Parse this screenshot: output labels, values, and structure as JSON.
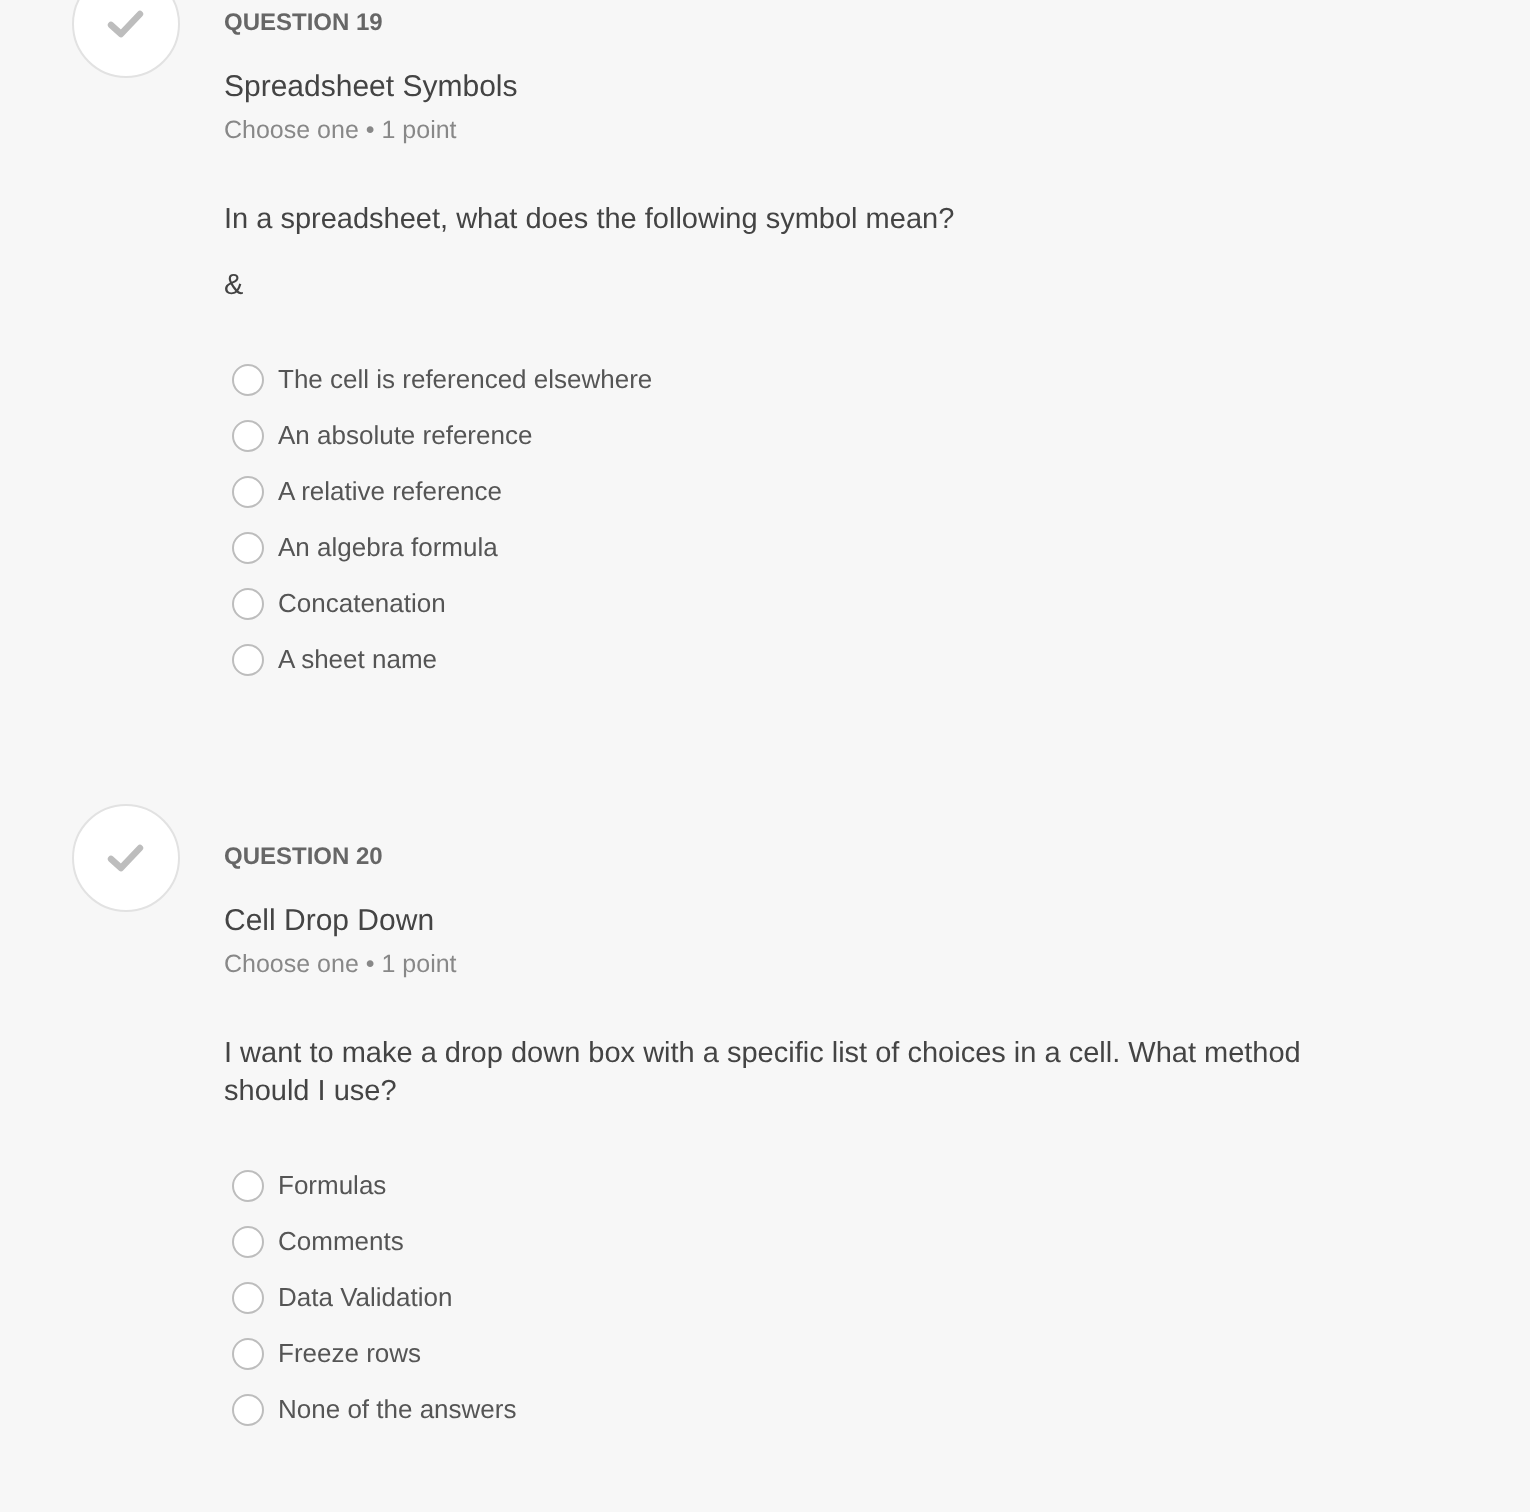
{
  "questions": [
    {
      "number_label": "QUESTION 19",
      "title": "Spreadsheet Symbols",
      "meta": "Choose one • 1 point",
      "prompt_paragraphs": [
        "In a spreadsheet, what does the following symbol mean?",
        "&"
      ],
      "options": [
        {
          "label": "The cell is referenced elsewhere",
          "selected": false
        },
        {
          "label": "An absolute reference",
          "selected": false
        },
        {
          "label": "A relative reference",
          "selected": false
        },
        {
          "label": "An algebra formula",
          "selected": false
        },
        {
          "label": "Concatenation",
          "selected": false
        },
        {
          "label": "A sheet name",
          "selected": false
        }
      ]
    },
    {
      "number_label": "QUESTION 20",
      "title": "Cell Drop Down",
      "meta": "Choose one • 1 point",
      "prompt_paragraphs": [
        "I want to make a drop down box with a specific list of choices in a cell. What method should I use?"
      ],
      "options": [
        {
          "label": "Formulas",
          "selected": false
        },
        {
          "label": "Comments",
          "selected": false
        },
        {
          "label": "Data Validation",
          "selected": false
        },
        {
          "label": "Freeze rows",
          "selected": false
        },
        {
          "label": "None of the answers",
          "selected": false
        }
      ]
    }
  ]
}
